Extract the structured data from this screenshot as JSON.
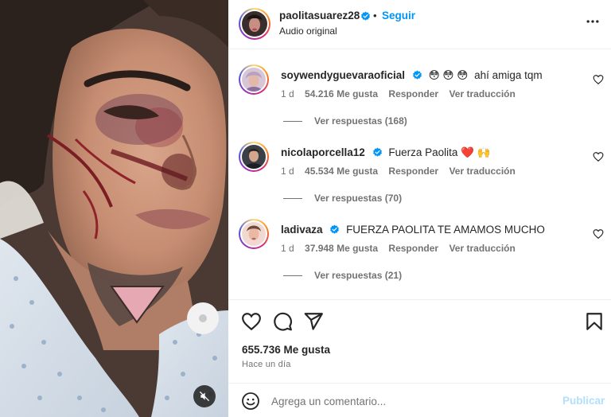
{
  "post": {
    "author": "paolitasuarez28",
    "separator": "•",
    "follow_label": "Seguir",
    "audio": "Audio original",
    "likes": "655.736 Me gusta",
    "time": "Hace un día"
  },
  "comments": [
    {
      "username": "soywendyguevaraoficial",
      "emoji": "😳 😳 😳",
      "text": "ahí amiga tqm",
      "age": "1 d",
      "likes": "54.216 Me gusta",
      "reply": "Responder",
      "translate": "Ver traducción",
      "replies": "Ver respuestas (168)"
    },
    {
      "username": "nicolaporcella12",
      "emoji": "",
      "text": "Fuerza Paolita ❤️ 🙌",
      "age": "1 d",
      "likes": "45.534 Me gusta",
      "reply": "Responder",
      "translate": "Ver traducción",
      "replies": "Ver respuestas (70)"
    },
    {
      "username": "ladivaza",
      "emoji": "",
      "text": "FUERZA PAOLITA TE AMAMOS MUCHO",
      "age": "1 d",
      "likes": "37.948 Me gusta",
      "reply": "Responder",
      "translate": "Ver traducción",
      "replies": "Ver respuestas (21)"
    }
  ],
  "composer": {
    "placeholder": "Agrega un comentario...",
    "publish_label": "Publicar"
  },
  "icons": {
    "verified": "verified-badge-icon",
    "more": "more-options-icon",
    "like": "heart-icon",
    "comment": "comment-bubble-icon",
    "share": "paper-plane-icon",
    "save": "bookmark-icon",
    "emoji": "emoji-smiley-icon",
    "mute": "speaker-muted-icon"
  },
  "colors": {
    "accent": "#0095f6",
    "text": "#262626",
    "secondary": "#737373",
    "divider": "#efefef",
    "publish_disabled": "#b2dffc"
  }
}
